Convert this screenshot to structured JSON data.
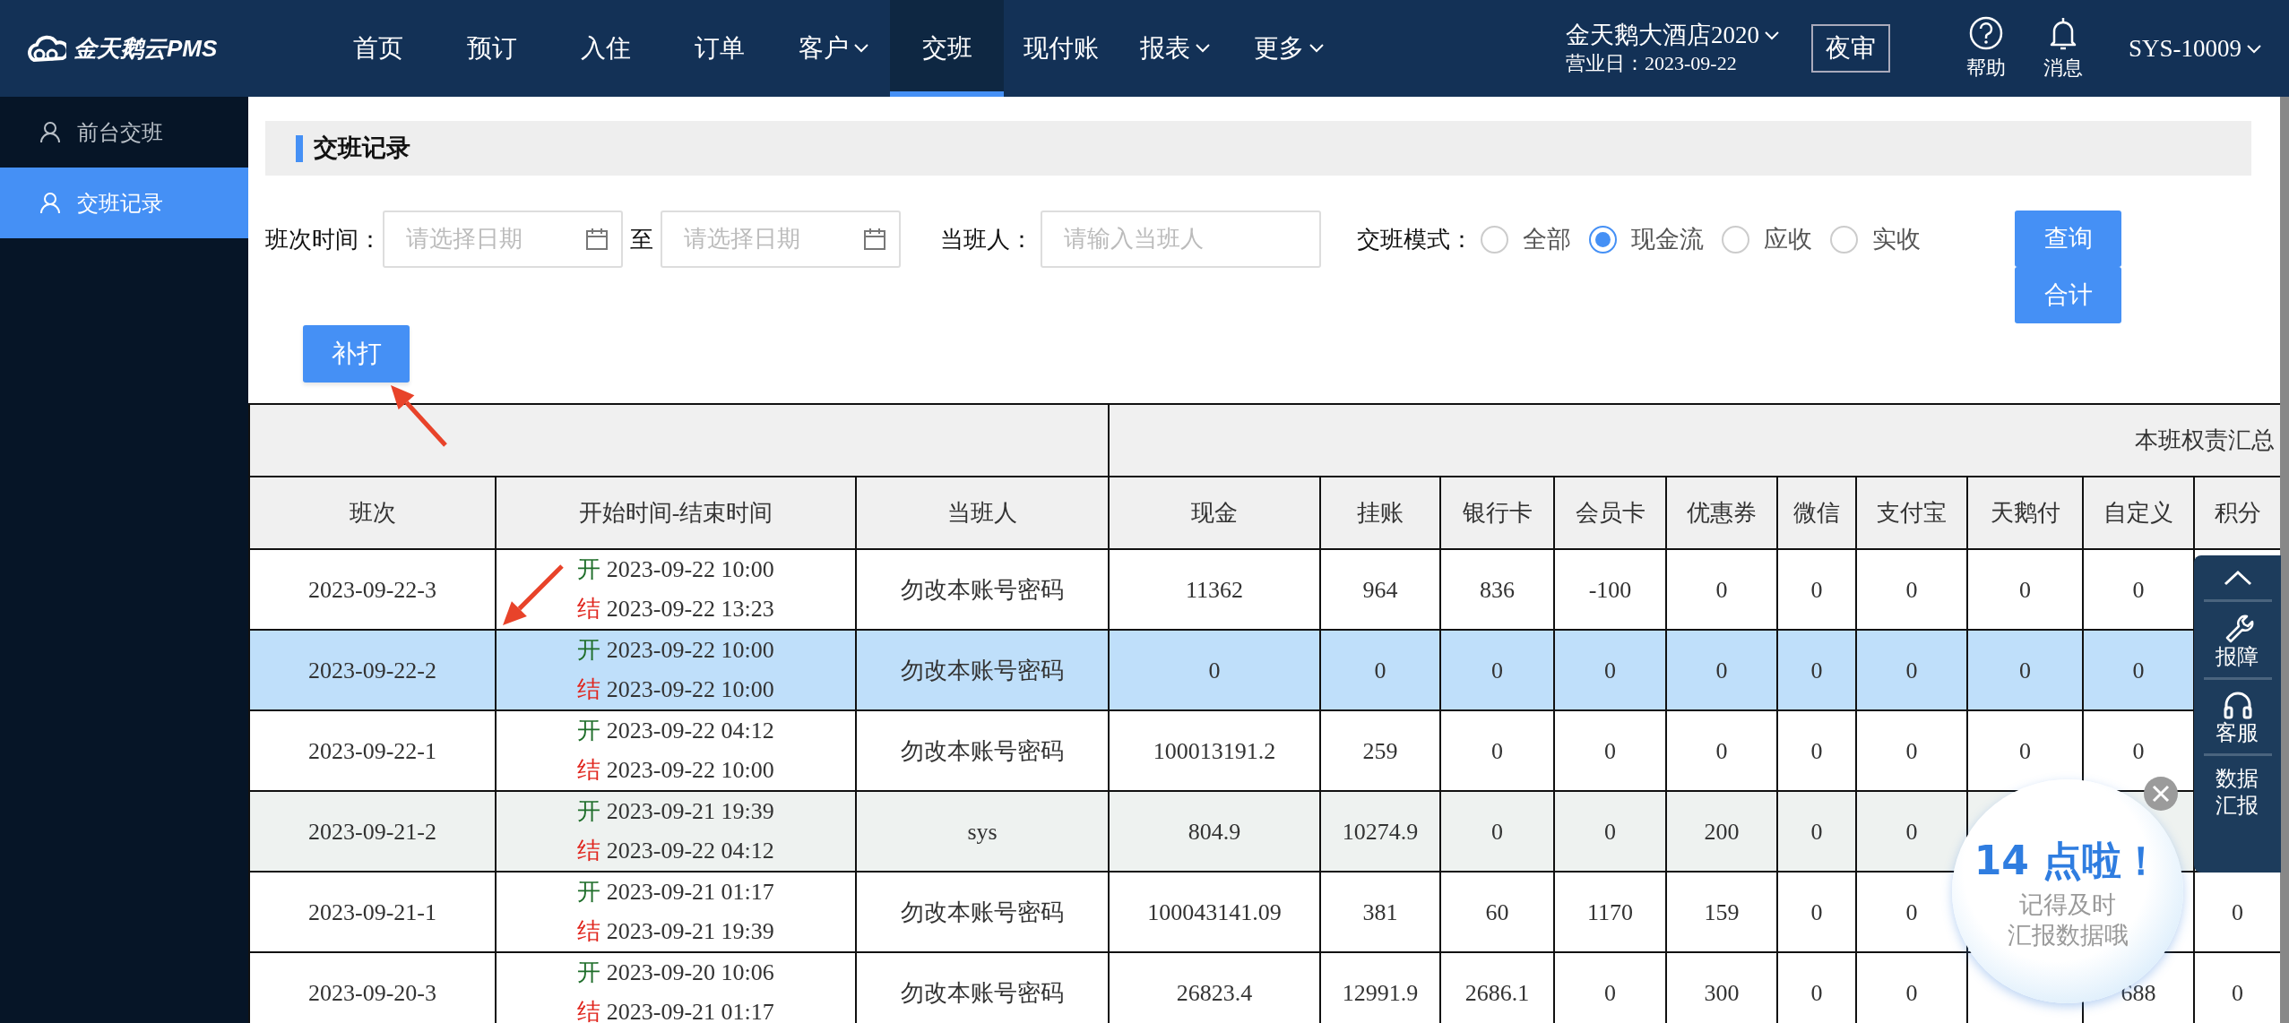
{
  "nav": {
    "logo": "金天鹅云PMS",
    "items": [
      {
        "label": "首页",
        "dropdown": false,
        "selected": false
      },
      {
        "label": "预订",
        "dropdown": false,
        "selected": false
      },
      {
        "label": "入住",
        "dropdown": false,
        "selected": false
      },
      {
        "label": "订单",
        "dropdown": false,
        "selected": false
      },
      {
        "label": "客户",
        "dropdown": true,
        "selected": false
      },
      {
        "label": "交班",
        "dropdown": false,
        "selected": true
      },
      {
        "label": "现付账",
        "dropdown": false,
        "selected": false
      },
      {
        "label": "报表",
        "dropdown": true,
        "selected": false
      },
      {
        "label": "更多",
        "dropdown": true,
        "selected": false
      }
    ]
  },
  "hotel": {
    "name": "金天鹅大酒店2020",
    "business_date": "营业日：2023-09-22"
  },
  "night_audit_button": "夜审",
  "tools": [
    {
      "kind": "help",
      "label": "帮助"
    },
    {
      "kind": "bell",
      "label": "消息"
    }
  ],
  "user": "SYS-10009",
  "sidebar": {
    "items": [
      {
        "label": "前台交班",
        "selected": false
      },
      {
        "label": "交班记录",
        "selected": true
      }
    ]
  },
  "section_title": "交班记录",
  "filters": {
    "shift_time_label": "班次时间：",
    "date_from": {
      "placeholder": "请选择日期"
    },
    "to_label": "至",
    "date_to": {
      "placeholder": "请选择日期"
    },
    "person_label": "当班人：",
    "person": {
      "placeholder": "请输入当班人"
    },
    "mode_label": "交班模式：",
    "modes": [
      {
        "label": "全部",
        "selected": false
      },
      {
        "label": "现金流",
        "selected": true
      },
      {
        "label": "应收",
        "selected": false
      },
      {
        "label": "实收",
        "selected": false
      }
    ]
  },
  "buttons": [
    "查询",
    "合计"
  ],
  "reprint_button": "补打",
  "table": {
    "group_header": "本班权责汇总",
    "columns": [
      "班次",
      "开始时间-结束时间",
      "当班人",
      "现金",
      "挂账",
      "银行卡",
      "会员卡",
      "优惠券",
      "微信",
      "支付宝",
      "天鹅付",
      "自定义",
      "积分"
    ],
    "rows": [
      {
        "cells": [
          {
            "kind": "value",
            "text": "2023-09-22-3"
          },
          {
            "kind": "times",
            "start_prefix": "开",
            "start": "2023-09-22 10:00",
            "end_prefix": "结",
            "end": "2023-09-22 13:23"
          },
          {
            "kind": "value",
            "text": "勿改本账号密码"
          },
          {
            "kind": "value",
            "text": "11362"
          },
          {
            "kind": "value",
            "text": "964"
          },
          {
            "kind": "value",
            "text": "836"
          },
          {
            "kind": "value",
            "text": "-100"
          },
          {
            "kind": "value",
            "text": "0"
          },
          {
            "kind": "value",
            "text": "0"
          },
          {
            "kind": "value",
            "text": "0"
          },
          {
            "kind": "value",
            "text": "0"
          },
          {
            "kind": "value",
            "text": "0"
          },
          {
            "kind": "covered"
          }
        ],
        "selected": false,
        "hovered": false
      },
      {
        "cells": [
          {
            "kind": "value",
            "text": "2023-09-22-2"
          },
          {
            "kind": "times",
            "start_prefix": "开",
            "start": "2023-09-22 10:00",
            "end_prefix": "结",
            "end": "2023-09-22 10:00"
          },
          {
            "kind": "value",
            "text": "勿改本账号密码"
          },
          {
            "kind": "value",
            "text": "0"
          },
          {
            "kind": "value",
            "text": "0"
          },
          {
            "kind": "value",
            "text": "0"
          },
          {
            "kind": "value",
            "text": "0"
          },
          {
            "kind": "value",
            "text": "0"
          },
          {
            "kind": "value",
            "text": "0"
          },
          {
            "kind": "value",
            "text": "0"
          },
          {
            "kind": "value",
            "text": "0"
          },
          {
            "kind": "value",
            "text": "0"
          },
          {
            "kind": "covered"
          }
        ],
        "selected": true,
        "hovered": false
      },
      {
        "cells": [
          {
            "kind": "value",
            "text": "2023-09-22-1"
          },
          {
            "kind": "times",
            "start_prefix": "开",
            "start": "2023-09-22 04:12",
            "end_prefix": "结",
            "end": "2023-09-22 10:00"
          },
          {
            "kind": "value",
            "text": "勿改本账号密码"
          },
          {
            "kind": "value",
            "text": "100013191.2"
          },
          {
            "kind": "value",
            "text": "259"
          },
          {
            "kind": "value",
            "text": "0"
          },
          {
            "kind": "value",
            "text": "0"
          },
          {
            "kind": "value",
            "text": "0"
          },
          {
            "kind": "value",
            "text": "0"
          },
          {
            "kind": "value",
            "text": "0"
          },
          {
            "kind": "value",
            "text": "0"
          },
          {
            "kind": "value",
            "text": "0"
          },
          {
            "kind": "covered"
          }
        ],
        "selected": false,
        "hovered": false
      },
      {
        "cells": [
          {
            "kind": "value",
            "text": "2023-09-21-2"
          },
          {
            "kind": "times",
            "start_prefix": "开",
            "start": "2023-09-21 19:39",
            "end_prefix": "结",
            "end": "2023-09-22 04:12"
          },
          {
            "kind": "value",
            "text": "sys"
          },
          {
            "kind": "value",
            "text": "804.9"
          },
          {
            "kind": "value",
            "text": "10274.9"
          },
          {
            "kind": "value",
            "text": "0"
          },
          {
            "kind": "value",
            "text": "0"
          },
          {
            "kind": "value",
            "text": "200"
          },
          {
            "kind": "value",
            "text": "0"
          },
          {
            "kind": "value",
            "text": "0"
          },
          {
            "kind": "covered"
          },
          {
            "kind": "covered"
          },
          {
            "kind": "covered"
          }
        ],
        "selected": false,
        "hovered": true
      },
      {
        "cells": [
          {
            "kind": "value",
            "text": "2023-09-21-1"
          },
          {
            "kind": "times",
            "start_prefix": "开",
            "start": "2023-09-21 01:17",
            "end_prefix": "结",
            "end": "2023-09-21 19:39"
          },
          {
            "kind": "value",
            "text": "勿改本账号密码"
          },
          {
            "kind": "value",
            "text": "100043141.09"
          },
          {
            "kind": "value",
            "text": "381"
          },
          {
            "kind": "value",
            "text": "60"
          },
          {
            "kind": "value",
            "text": "1170"
          },
          {
            "kind": "value",
            "text": "159"
          },
          {
            "kind": "value",
            "text": "0"
          },
          {
            "kind": "value",
            "text": "0"
          },
          {
            "kind": "covered"
          },
          {
            "kind": "covered"
          },
          {
            "kind": "value",
            "text": "0"
          }
        ],
        "selected": false,
        "hovered": false
      },
      {
        "cells": [
          {
            "kind": "value",
            "text": "2023-09-20-3"
          },
          {
            "kind": "times",
            "start_prefix": "开",
            "start": "2023-09-20 10:06",
            "end_prefix": "结",
            "end": "2023-09-21 01:17"
          },
          {
            "kind": "value",
            "text": "勿改本账号密码"
          },
          {
            "kind": "value",
            "text": "26823.4"
          },
          {
            "kind": "value",
            "text": "12991.9"
          },
          {
            "kind": "value",
            "text": "2686.1"
          },
          {
            "kind": "value",
            "text": "0"
          },
          {
            "kind": "value",
            "text": "300"
          },
          {
            "kind": "value",
            "text": "0"
          },
          {
            "kind": "value",
            "text": "0"
          },
          {
            "kind": "covered"
          },
          {
            "kind": "value",
            "text": "688"
          },
          {
            "kind": "value",
            "text": "0"
          }
        ],
        "selected": false,
        "hovered": false
      }
    ]
  },
  "float_panel": [
    {
      "kind": "up"
    },
    {
      "kind": "wrench",
      "label": "报障"
    },
    {
      "kind": "headset",
      "label": "客服"
    },
    {
      "kind": "text",
      "label": "数据汇报"
    }
  ],
  "popup": {
    "headline": "14 点啦！",
    "lines": [
      "记得及时",
      "汇报数据哦"
    ]
  },
  "annotations": [
    {
      "kind": "arrow"
    },
    {
      "kind": "arrow"
    }
  ]
}
